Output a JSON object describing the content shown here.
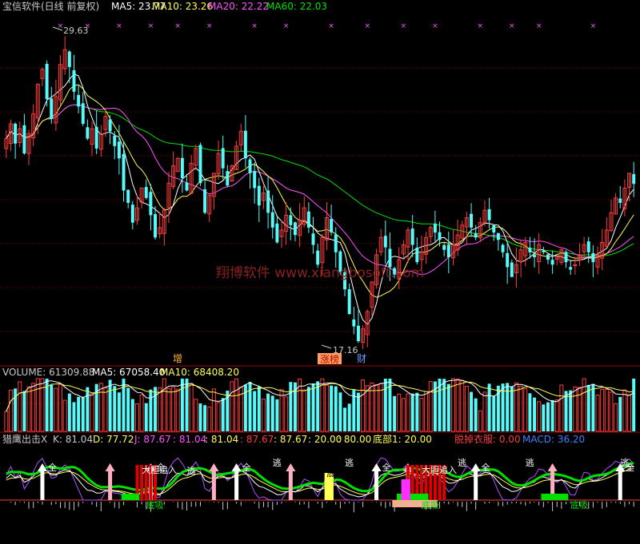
{
  "colors": {
    "up": "#ff3c3c",
    "down": "#54fcfc",
    "ma5": "#ffffff",
    "ma10": "#ffff54",
    "ma20": "#ff54ff",
    "ma60": "#00e000",
    "grid": "#a00000",
    "text": "#c0c0c0"
  },
  "header": {
    "title": "宝信软件(日线 前复权)",
    "ma5_label": "MA5: 23.77",
    "ma10_label": "MA10: 23.26",
    "ma20_label": "MA20: 22.22",
    "ma60_label": "MA60: 22.03"
  },
  "price": {
    "high_label": "29.63",
    "low_label": "17.16",
    "event_labels": [
      "增",
      "涨榜",
      "财"
    ]
  },
  "watermark": "翔博软件 www.xiangbosoft.com",
  "volume": {
    "label": "VOLUME: 61309.88",
    "ma5_label": "MA5: 67058.40",
    "ma10_label": "MA10: 68408.20"
  },
  "indicator": {
    "title": "猎鹰出击X",
    "k_label": "K: 81.04",
    "d_label": "D: 77.72",
    "j_label": "J: 87.67",
    "values": [
      ": 81.04",
      ": 81.04",
      ": 87.67",
      ": 87.67",
      ": 20.00",
      ": 80.00"
    ],
    "bottom_label": "底部1: 20.00",
    "escape_label": "脱掉衣服: 0.00",
    "macd_label": "MACD: 36.20",
    "annotations": [
      "全",
      "逃",
      "大胆追入",
      "底吸",
      "底部"
    ]
  },
  "chart_data": [
    {
      "type": "candlestick",
      "title": "宝信软件(日线 前复权)",
      "series": [
        {
          "name": "MA5",
          "value": 23.77
        },
        {
          "name": "MA10",
          "value": 23.26
        },
        {
          "name": "MA20",
          "value": 22.22
        },
        {
          "name": "MA60",
          "value": 22.03
        }
      ],
      "ylim": [
        16.5,
        30.5
      ],
      "annotations": [
        {
          "text": "29.63"
        },
        {
          "text": "17.16"
        }
      ],
      "close": [
        25.6,
        26.2,
        25.4,
        26.0,
        25.0,
        25.8,
        26.6,
        27.8,
        28.4,
        27.2,
        26.4,
        27.3,
        28.6,
        29.2,
        28.5,
        27.5,
        26.9,
        26.2,
        25.6,
        26.0,
        25.2,
        25.8,
        26.5,
        25.9,
        25.3,
        24.8,
        23.5,
        23.0,
        22.2,
        22.8,
        23.6,
        23.2,
        22.5,
        21.6,
        22.0,
        22.7,
        23.8,
        24.5,
        24.8,
        24.0,
        23.5,
        24.6,
        25.2,
        23.8,
        22.6,
        23.3,
        24.2,
        25.0,
        24.4,
        23.7,
        24.5,
        25.3,
        25.9,
        24.8,
        24.2,
        23.6,
        22.9,
        23.4,
        22.6,
        22.0,
        21.4,
        21.9,
        22.5,
        22.1,
        21.7,
        22.3,
        22.8,
        22.0,
        21.3,
        20.5,
        21.6,
        22.4,
        21.8,
        21.0,
        20.2,
        19.5,
        18.5,
        18.0,
        17.4,
        17.9,
        18.6,
        19.8,
        20.9,
        21.6,
        21.2,
        20.4,
        20.1,
        20.7,
        21.3,
        21.9,
        21.3,
        20.6,
        21.0,
        21.6,
        22.0,
        21.8,
        21.5,
        21.1,
        20.8,
        21.3,
        21.7,
        22.1,
        22.4,
        22.0,
        21.6,
        22.2,
        22.7,
        22.3,
        21.8,
        21.5,
        21.0,
        20.4,
        20.0,
        20.5,
        21.1,
        21.4,
        21.0,
        20.8,
        21.3,
        21.0,
        20.7,
        20.5,
        20.8,
        21.1,
        20.6,
        20.3,
        20.5,
        20.9,
        21.3,
        21.0,
        20.6,
        20.9,
        21.4,
        21.9,
        22.6,
        23.2,
        23.0,
        23.6,
        24.2,
        23.77
      ]
    },
    {
      "type": "bar",
      "title": "VOLUME",
      "series": [
        {
          "name": "VOLUME",
          "value": 61309.88
        },
        {
          "name": "MA5",
          "value": 67058.4
        },
        {
          "name": "MA10",
          "value": 68408.2
        }
      ]
    },
    {
      "type": "line",
      "title": "猎鹰出击X",
      "series": [
        {
          "name": "K",
          "value": 81.04
        },
        {
          "name": "D",
          "value": 77.72
        },
        {
          "name": "J",
          "value": 87.67
        },
        {
          "name": "底部1",
          "value": 20.0
        },
        {
          "name": "脱掉衣服",
          "value": 0.0
        },
        {
          "name": "MACD",
          "value": 36.2
        }
      ]
    }
  ]
}
